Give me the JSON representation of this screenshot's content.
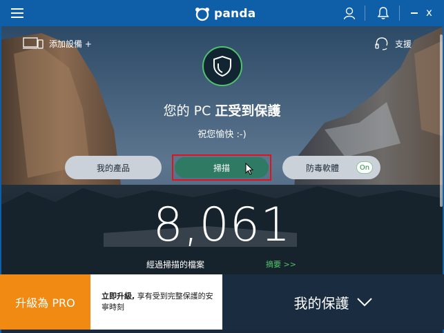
{
  "app": {
    "logo_text": "panda"
  },
  "header": {
    "add_device_label": "添加設備 +",
    "support_label": "支援",
    "close_glyph": "x"
  },
  "status": {
    "prefix": "您的 PC ",
    "emphasis": "正受到保護",
    "subtitle": "祝您愉快 :-)"
  },
  "buttons": {
    "my_products": "我的產品",
    "scan": "掃描",
    "antivirus": "防毒軟體",
    "antivirus_toggle": "On"
  },
  "stats": {
    "scanned_count": "8,061",
    "scanned_label": "經過掃描的檔案",
    "summary_link": "摘要 >>"
  },
  "bottom": {
    "upgrade_label": "升級為 PRO",
    "promo_bold": "立即升級,",
    "promo_text": "享有受到完整保護的安寧時刻",
    "my_protection_label": "我的保護"
  },
  "colors": {
    "titlebar": "#0f5fa8",
    "accent_green": "#4ec46e",
    "scan_button": "#2f7a63",
    "upgrade_orange": "#f08a13",
    "highlight_red": "#e2121b",
    "bottom_dark": "#1a2c40"
  },
  "icons": {
    "menu": "hamburger-icon",
    "user": "user-icon",
    "notifications": "bell-icon",
    "minimize": "minimize-icon",
    "close": "close-icon",
    "add_device": "devices-icon",
    "support": "headset-icon",
    "shield": "shield-icon",
    "cursor": "mouse-cursor-icon",
    "expand": "chevron-down-icon"
  }
}
